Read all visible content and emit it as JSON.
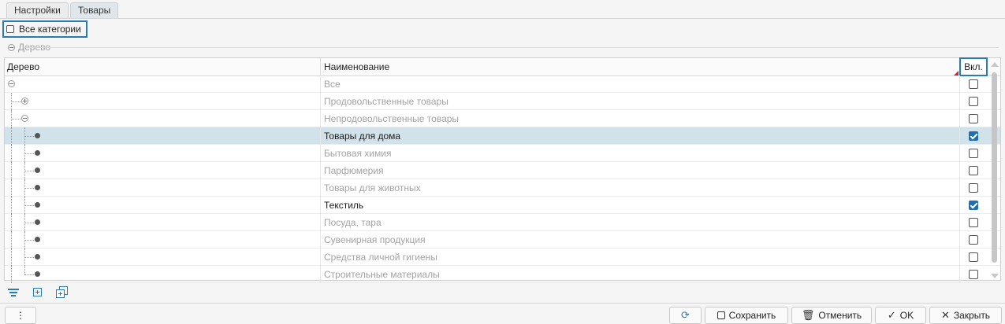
{
  "tabs": [
    {
      "label": "Настройки"
    },
    {
      "label": "Товары"
    }
  ],
  "filter": {
    "all_categories_label": "Все категории",
    "checked": false
  },
  "group": {
    "label": "Дерево"
  },
  "grid": {
    "columns": {
      "tree": "Дерево",
      "name": "Наименование",
      "included": "Вкл."
    },
    "rows": [
      {
        "name": "Все",
        "level": 0,
        "node": "expanded",
        "included": false,
        "active": false
      },
      {
        "name": "Продовольственные товары",
        "level": 1,
        "node": "collapsed",
        "included": false,
        "active": false
      },
      {
        "name": "Непродовольственные товары",
        "level": 1,
        "node": "expanded",
        "included": false,
        "active": false
      },
      {
        "name": "Товары для дома",
        "level": 2,
        "node": "leaf",
        "included": true,
        "active": true,
        "selected": true
      },
      {
        "name": "Бытовая химия",
        "level": 2,
        "node": "leaf",
        "included": false,
        "active": false
      },
      {
        "name": "Парфюмерия",
        "level": 2,
        "node": "leaf",
        "included": false,
        "active": false
      },
      {
        "name": "Товары для животных",
        "level": 2,
        "node": "leaf",
        "included": false,
        "active": false
      },
      {
        "name": "Текстиль",
        "level": 2,
        "node": "leaf",
        "included": true,
        "active": true
      },
      {
        "name": "Посуда, тара",
        "level": 2,
        "node": "leaf",
        "included": false,
        "active": false
      },
      {
        "name": "Сувенирная продукция",
        "level": 2,
        "node": "leaf",
        "included": false,
        "active": false
      },
      {
        "name": "Средства личной гигиены",
        "level": 2,
        "node": "leaf",
        "included": false,
        "active": false
      },
      {
        "name": "Строительные материалы",
        "level": 2,
        "node": "leaf",
        "included": false,
        "active": false
      }
    ]
  },
  "toolbar_icons": [
    "filter-icon",
    "add-icon",
    "add-copy-icon"
  ],
  "buttons": {
    "more": "⋮",
    "save": "Сохранить",
    "cancel": "Отменить",
    "ok": "OK",
    "close": "Закрыть"
  },
  "colors": {
    "accent": "#2a7ab8",
    "selected_row": "#d2e2ea",
    "checked": "#1f6fb8"
  }
}
